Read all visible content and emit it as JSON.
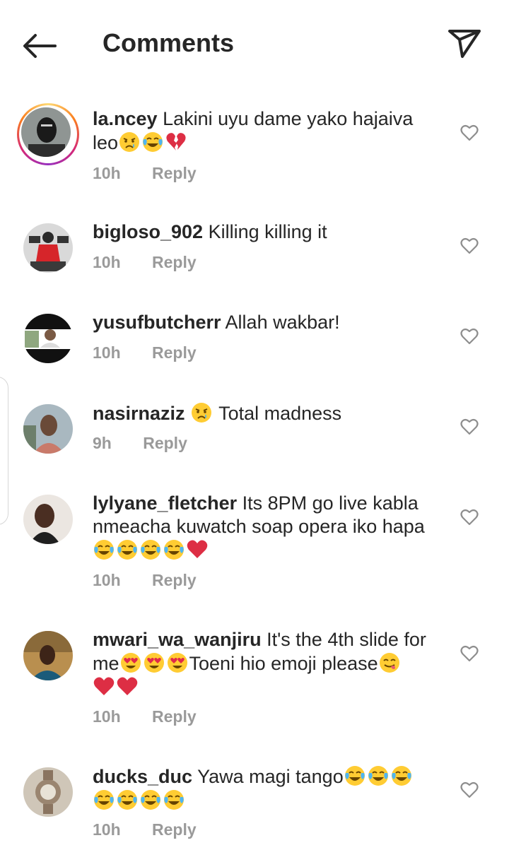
{
  "header": {
    "title": "Comments",
    "back_icon": "arrow-left-icon",
    "send_icon": "paper-plane-icon"
  },
  "comments": [
    {
      "username": "la.ncey",
      "text": "Lakini uyu dame yako hajaiva",
      "text2": "leo",
      "emojis_line2": [
        "crying-face",
        "tears-of-joy",
        "broken-heart"
      ],
      "time": "10h",
      "reply": "Reply",
      "has_story": true
    },
    {
      "username": "bigloso_902",
      "text": "Killing killing it",
      "time": "10h",
      "reply": "Reply"
    },
    {
      "username": "yusufbutcherr",
      "text": "Allah wakbar!",
      "time": "10h",
      "reply": "Reply"
    },
    {
      "username": "nasirnaziz",
      "text": "Total madness",
      "emoji_before_text": "crying-face",
      "time": "9h",
      "reply": "Reply"
    },
    {
      "username": "lylyane_fletcher",
      "text": "Its 8PM go live kabla",
      "text2": "nmeacha kuwatch soap opera iko hapa",
      "emojis_line3": [
        "tears-of-joy",
        "tears-of-joy",
        "tears-of-joy",
        "tears-of-joy",
        "red-heart"
      ],
      "time": "10h",
      "reply": "Reply"
    },
    {
      "username": "mwari_wa_wanjiru",
      "text": "It's the 4th slide for",
      "text2_prefix": "me",
      "text2_suffix": "Toeni hio emoji please",
      "emojis_line2a": [
        "heart-eyes",
        "heart-eyes",
        "heart-eyes"
      ],
      "emoji_line2b": "yum-face",
      "emojis_line3": [
        "red-heart",
        "red-heart"
      ],
      "time": "10h",
      "reply": "Reply"
    },
    {
      "username": "ducks_duc",
      "text": "Yawa magi tango",
      "emojis_line1": [
        "tears-of-joy",
        "tears-of-joy",
        "tears-of-joy"
      ],
      "emojis_line2": [
        "tears-of-joy",
        "tears-of-joy",
        "tears-of-joy",
        "tears-of-joy"
      ],
      "time": "10h",
      "reply": "Reply"
    }
  ],
  "colors": {
    "text": "#262626",
    "meta": "#9a9a9a",
    "heart_outline": "#8e8e8e"
  }
}
